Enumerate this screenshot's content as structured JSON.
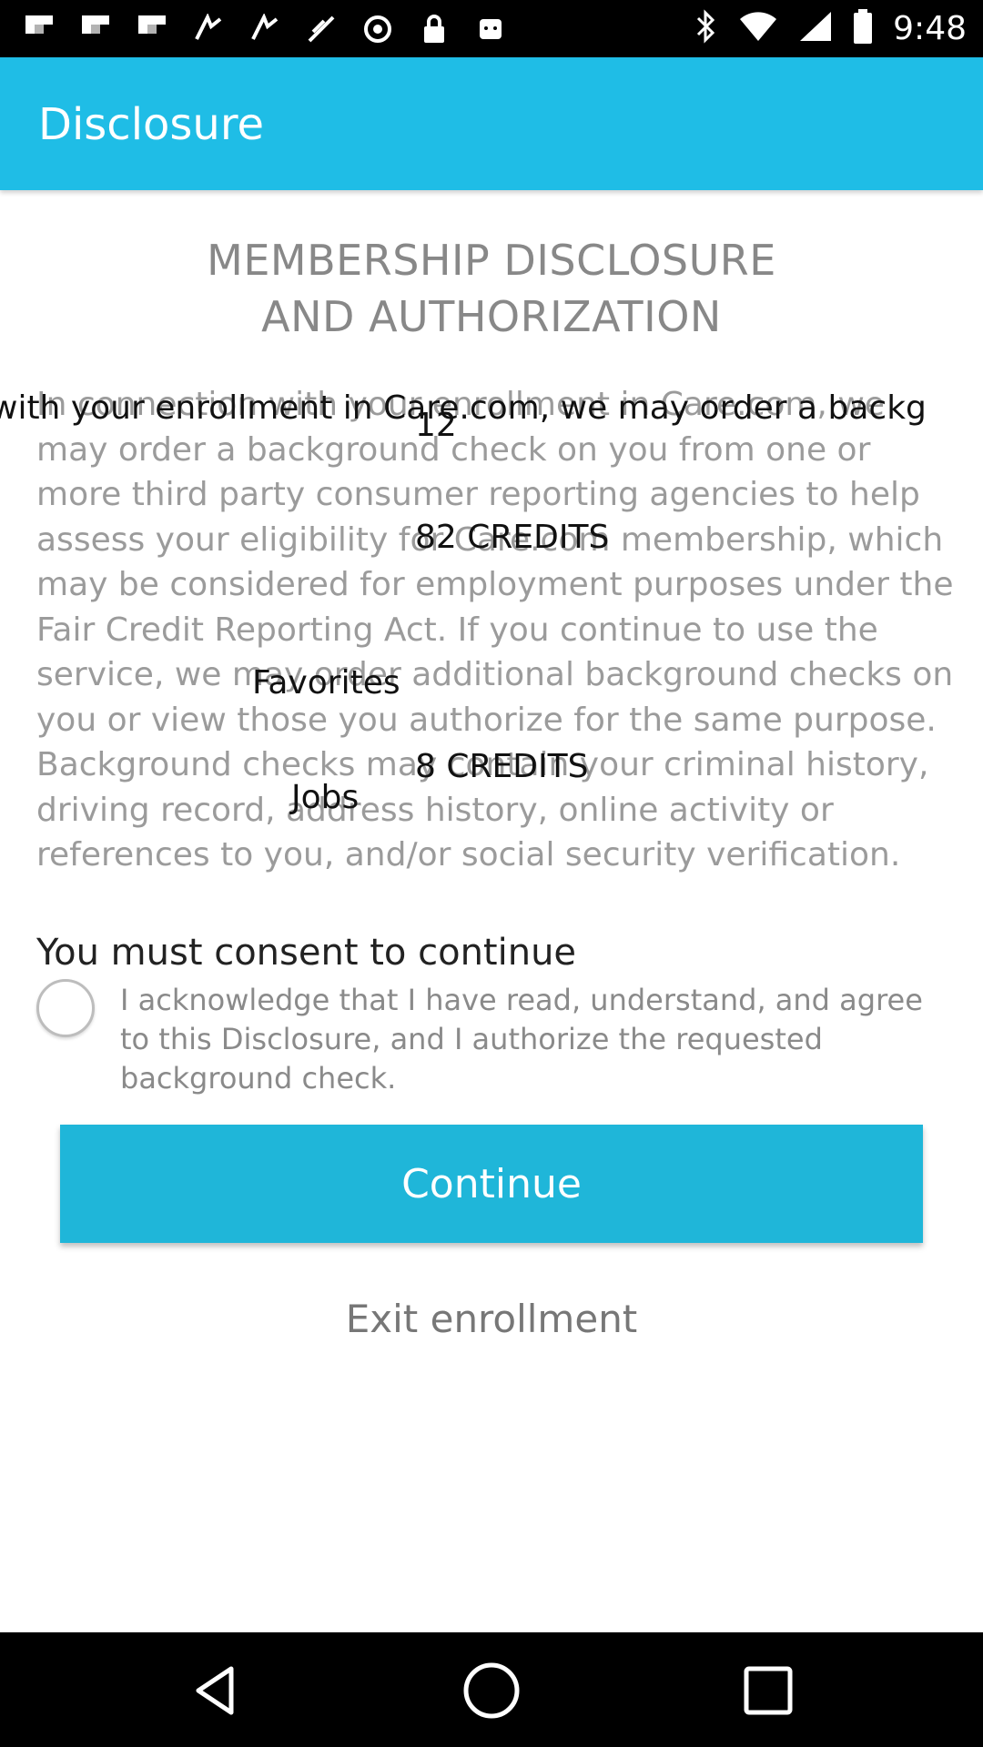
{
  "status_bar": {
    "time": "9:48",
    "icons_left": [
      "flipboard-icon",
      "flipboard-icon",
      "flipboard-icon",
      "signal-boost-icon",
      "signal-boost-icon",
      "no-sim-icon",
      "blocked-icon",
      "lock-icon",
      "android-icon"
    ],
    "icons_right": [
      "bluetooth-icon",
      "wifi-icon",
      "cell-signal-icon",
      "battery-icon"
    ]
  },
  "app_bar": {
    "title": "Disclosure",
    "color": "#1fbde6"
  },
  "content": {
    "heading_line1": "MEMBERSHIP DISCLOSURE",
    "heading_line2": "AND AUTHORIZATION",
    "body": "In connection with your enrollment in Care.com, we may order a background check on you from one or more third party consumer reporting agencies to help assess your eligibility for Care.com membership, which may be considered for employment purposes under the Fair Credit Reporting Act. If you continue to use the service, we may order additional background checks on you or view those you authorize for the same purpose. Background checks may contain your criminal history, driving record, address history, online activity or references to you, and/or social security verification.",
    "overlay_line": "with your enrollment in Care.com, we may order a backg",
    "overlay_12": "12",
    "overlay_82": "82 CREDITS",
    "overlay_favorites": "Favorites",
    "overlay_8": "8 CREDITS",
    "overlay_jobs": "Jobs",
    "consent_title": "You must consent to continue",
    "acknowledge": "I acknowledge that I have read, understand, and agree to this Disclosure, and I authorize the requested background check.",
    "acknowledge_checked": false,
    "continue_label": "Continue",
    "exit_label": "Exit enrollment",
    "button_color": "#1fb6d9"
  },
  "nav_bar": {
    "buttons": [
      "back-icon",
      "home-icon",
      "recents-icon"
    ]
  }
}
